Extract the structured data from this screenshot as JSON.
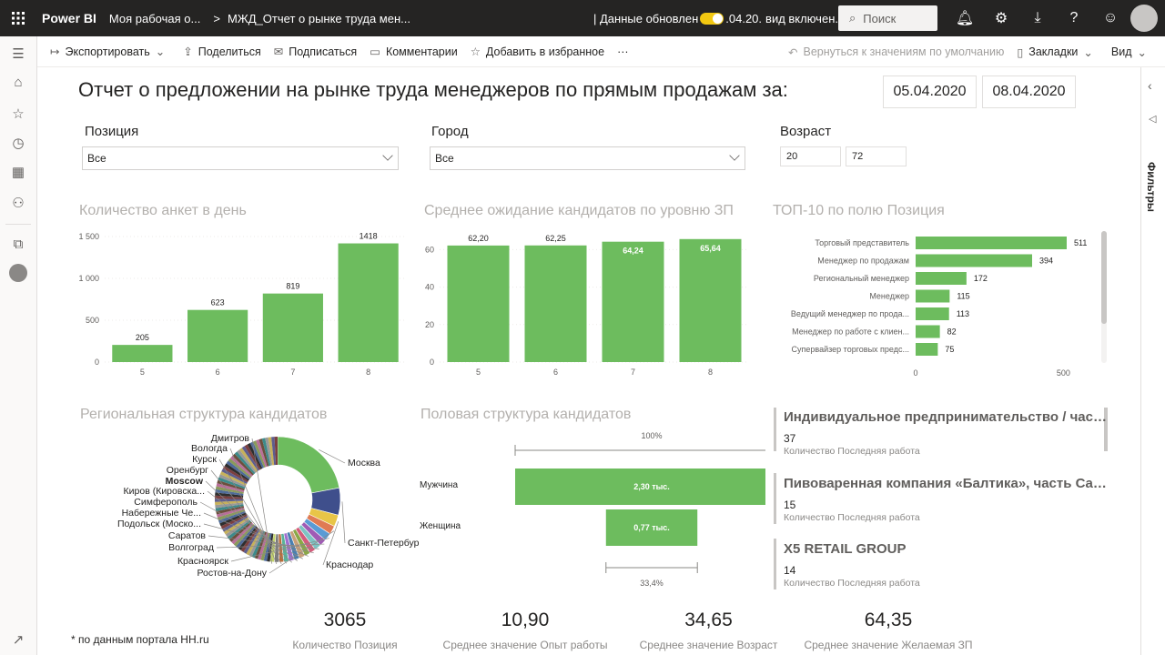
{
  "topbar": {
    "brand": "Power BI",
    "workspace": "Моя рабочая о...",
    "separator": ">",
    "report": "МЖД_Отчет о рынке труда мен...",
    "refresh_prefix": "| Данные обновлен",
    "refresh_mid": ".04.20.",
    "refresh_suffix": "вид включен.",
    "search_placeholder": "Поиск"
  },
  "cmdbar": {
    "export": "Экспортировать",
    "share": "Поделиться",
    "subscribe": "Подписаться",
    "comments": "Комментарии",
    "favorite": "Добавить в избранное",
    "more": "···",
    "reset": "Вернуться к значениям по умолчанию",
    "bookmarks": "Закладки",
    "view": "Вид"
  },
  "filters_pane": {
    "label": "Фильтры"
  },
  "report": {
    "title": "Отчет о предложении на рынке труда менеджеров по прямым продажам за:",
    "date_from": "05.04.2020",
    "date_to": "08.04.2020",
    "slicer_position": {
      "label": "Позиция",
      "value": "Все"
    },
    "slicer_city": {
      "label": "Город",
      "value": "Все"
    },
    "slicer_age": {
      "label": "Возраст",
      "min": "20",
      "max": "72"
    },
    "footnote": "* по данным портала HH.ru"
  },
  "colors": {
    "bar": "#6dbc5e",
    "accent": "#f2c811",
    "dark": "#252423"
  },
  "chart_data": [
    {
      "id": "daily",
      "type": "bar",
      "title": "Количество анкет в день",
      "categories": [
        "5",
        "6",
        "7",
        "8"
      ],
      "values": [
        205,
        623,
        819,
        1418
      ],
      "data_labels": [
        "205",
        "623",
        "819",
        "1418"
      ],
      "yticks": [
        "0",
        "500",
        "1 000",
        "1 500"
      ],
      "ytick_values": [
        0,
        500,
        1000,
        1500
      ],
      "ylim": [
        0,
        1500
      ]
    },
    {
      "id": "salary",
      "type": "bar",
      "title": "Среднее ожидание кандидатов по уровню ЗП",
      "categories": [
        "5",
        "6",
        "7",
        "8"
      ],
      "values": [
        62.2,
        62.25,
        64.24,
        65.64
      ],
      "data_labels": [
        "62,20",
        "62,25",
        "64,24",
        "65,64"
      ],
      "yticks": [
        "0",
        "20",
        "40",
        "60"
      ],
      "ytick_values": [
        0,
        20,
        40,
        60
      ],
      "ylim": [
        0,
        67
      ]
    },
    {
      "id": "top10",
      "type": "bar",
      "orientation": "horizontal",
      "title": "ТОП-10 по полю Позиция",
      "categories": [
        "Торговый представитель",
        "Менеджер по продажам",
        "Региональный менеджер",
        "Менеджер",
        "Ведущий менеджер по прода...",
        "Менеджер по работе с клиен...",
        "Супервайзер торговых предс..."
      ],
      "values": [
        511,
        394,
        172,
        115,
        113,
        82,
        75
      ],
      "data_labels": [
        "511",
        "394",
        "172",
        "115",
        "113",
        "82",
        "75"
      ],
      "xticks": [
        "0",
        "500"
      ],
      "xtick_values": [
        0,
        500
      ],
      "xlim": [
        0,
        511
      ]
    },
    {
      "id": "regions",
      "type": "pie",
      "title": "Региональная структура кандидатов",
      "labels": [
        "Москва",
        "Санкт-Петербург",
        "Краснодар",
        "Ростов-на-Дону",
        "Красноярск",
        "Волгоград",
        "Саратов",
        "Подольск (Моско...",
        "Набережные Че...",
        "Симферополь",
        "Киров (Кировска...",
        "Moscow",
        "Оренбург",
        "Курск",
        "Вологда",
        "Дмитров"
      ],
      "values": [
        22,
        7,
        3,
        2.2,
        2,
        1.8,
        1.7,
        1.6,
        1.5,
        1.5,
        1.4,
        1.4,
        1.3,
        1.2,
        1.2,
        1.1
      ],
      "colors": [
        "#6dbc5e",
        "#3f4f8c",
        "#e8c547",
        "#e07b54",
        "#5a9bd5",
        "#a05bb5",
        "#7dc4c4",
        "#d45c7b",
        "#8aa847",
        "#c9a07a",
        "#4a7fb0",
        "#9f6fcf",
        "#58b39a",
        "#b86d3a",
        "#7a7a7a",
        "#c3d36b"
      ],
      "other_value": 48
    },
    {
      "id": "gender",
      "type": "funnel",
      "title": "Половая структура кандидатов",
      "categories": [
        "Мужчина",
        "Женщина"
      ],
      "values": [
        2300,
        770
      ],
      "data_labels": [
        "2,30 тыс.",
        "0,77 тыс."
      ],
      "top_label": "100%",
      "bottom_label": "33,4%"
    }
  ],
  "cards": [
    {
      "title": "Индивидуальное предпринимательство / част...",
      "value": "37",
      "label": "Количество Последняя работа"
    },
    {
      "title": "Пивоваренная компания «Балтика», часть Carl...",
      "value": "15",
      "label": "Количество Последняя работа"
    },
    {
      "title": "X5 RETAIL GROUP",
      "value": "14",
      "label": "Количество Последняя работа"
    }
  ],
  "kpis": [
    {
      "value": "3065",
      "label": "Количество Позиция"
    },
    {
      "value": "10,90",
      "label": "Среднее значение Опыт работы"
    },
    {
      "value": "34,65",
      "label": "Среднее значение Возраст"
    },
    {
      "value": "64,35",
      "label": "Среднее значение Желаемая ЗП"
    }
  ]
}
